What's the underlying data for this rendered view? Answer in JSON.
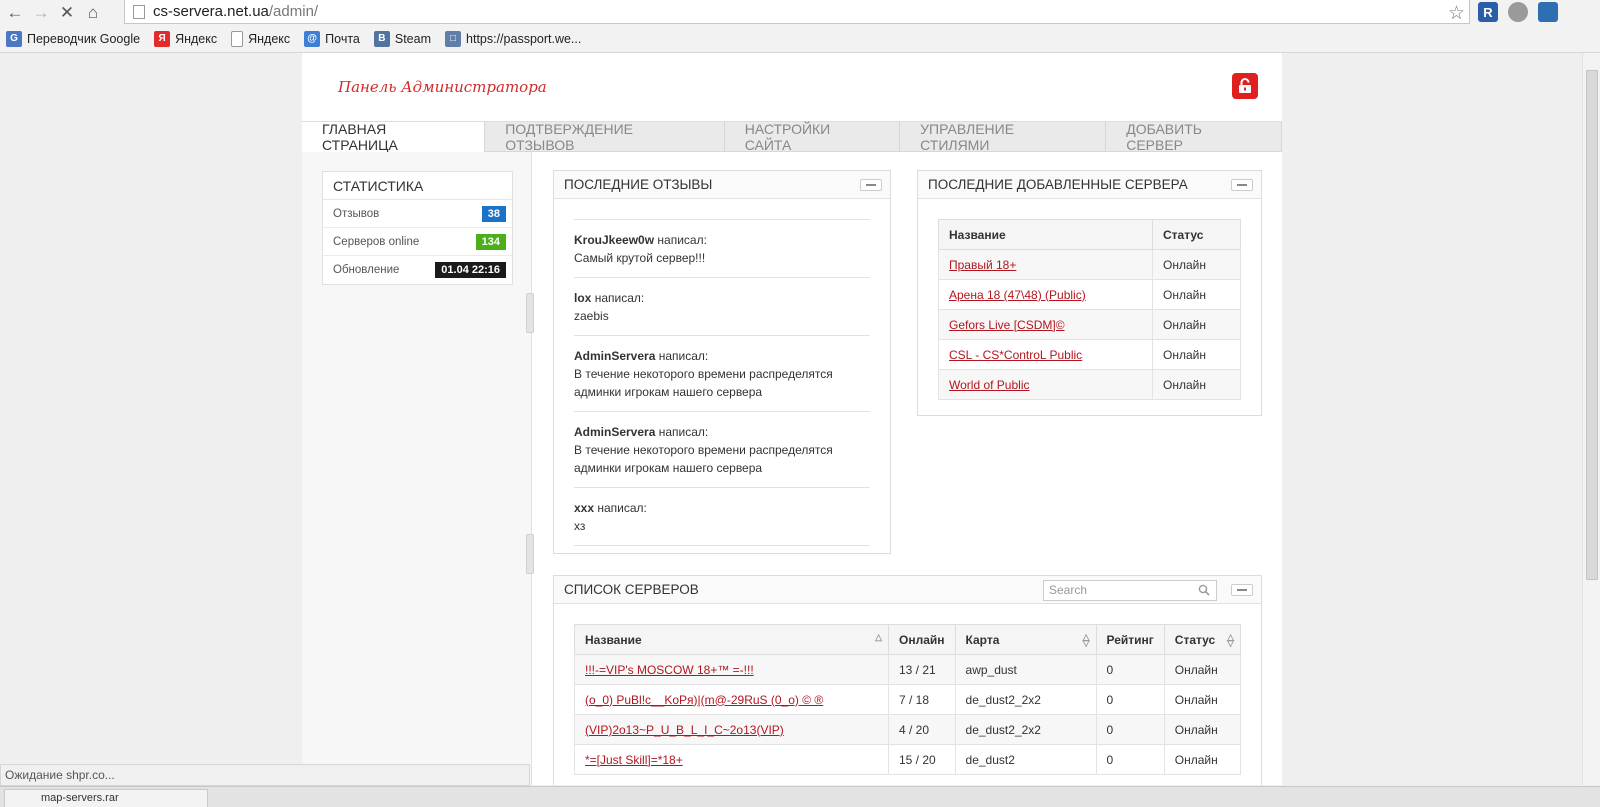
{
  "browser": {
    "url_host": "cs-servera.net.ua",
    "url_path": "/admin/",
    "bookmarks": [
      {
        "label": "Переводчик Google",
        "icon": "google-translate-icon"
      },
      {
        "label": "Яндекс",
        "icon": "yandex-icon"
      },
      {
        "label": "Яндекс",
        "icon": "page-icon"
      },
      {
        "label": "Почта",
        "icon": "mail-icon"
      },
      {
        "label": "Steam",
        "icon": "vk-icon"
      },
      {
        "label": "https://passport.we...",
        "icon": "chat-icon"
      }
    ],
    "status_text": "Ожидание shpr.co...",
    "download_label": "map-servers.rar"
  },
  "header": {
    "title": "Панель Администратора"
  },
  "tabs": [
    {
      "label": "ГЛАВНАЯ СТРАНИЦА",
      "active": true
    },
    {
      "label": "ПОДТВЕРЖДЕНИЕ ОТЗЫВОВ",
      "active": false
    },
    {
      "label": "НАСТРОЙКИ САЙТА",
      "active": false
    },
    {
      "label": "УПРАВЛЕНИЕ СТИЛЯМИ",
      "active": false
    },
    {
      "label": "ДОБАВИТЬ СЕРВЕР",
      "active": false
    }
  ],
  "stats": {
    "title": "СТАТИСТИКА",
    "rows": [
      {
        "label": "Отзывов",
        "value": "38",
        "color": "#1a73c9"
      },
      {
        "label": "Серверов online",
        "value": "134",
        "color": "#4caf1a"
      },
      {
        "label": "Обновление",
        "value": "01.04 22:16",
        "color": "#1a1a1a"
      }
    ]
  },
  "reviews": {
    "title": "ПОСЛЕДНИЕ ОТЗЫВЫ",
    "items": [
      {
        "author": "KrouJkeew0w",
        "wrote": "написал:",
        "text": "Самый крутой сервер!!!"
      },
      {
        "author": "lox",
        "wrote": "написал:",
        "text": "zaebis"
      },
      {
        "author": "AdminServera",
        "wrote": "написал:",
        "text": "В течение некоторого времени распределятся админки игрокам нашего сервера"
      },
      {
        "author": "AdminServera",
        "wrote": "написал:",
        "text": "В течение некоторого времени распределятся админки игрокам нашего сервера"
      },
      {
        "author": "xxx",
        "wrote": "написал:",
        "text": "хз"
      }
    ]
  },
  "recent_servers": {
    "title": "ПОСЛЕДНИЕ ДОБАВЛЕННЫЕ СЕРВЕРА",
    "columns": [
      "Название",
      "Статус"
    ],
    "rows": [
      {
        "name": "Правый 18+",
        "status": "Онлайн"
      },
      {
        "name": "Арена 18 (47\\48) (Public)",
        "status": "Онлайн"
      },
      {
        "name": "Gefors Live [CSDM]©",
        "status": "Онлайн"
      },
      {
        "name": "CSL - CS*ControL Public",
        "status": "Онлайн"
      },
      {
        "name": "World of Public",
        "status": "Онлайн"
      }
    ]
  },
  "server_list": {
    "title": "СПИСОК СЕРВЕРОВ",
    "search_placeholder": "Search",
    "columns": [
      "Название",
      "Онлайн",
      "Карта",
      "Рейтинг",
      "Статус"
    ],
    "rows": [
      {
        "name": "!!!-=VIP's MOSCOW 18+™ =-!!!",
        "online": "13 / 21",
        "map": "awp_dust",
        "rating": "0",
        "status": "Онлайн"
      },
      {
        "name": "(o_0) PuBl!c__KoPя)|(m@-29RuS (0_o) © ®",
        "online": "7 / 18",
        "map": "de_dust2_2x2",
        "rating": "0",
        "status": "Онлайн"
      },
      {
        "name": "(VIP)2o13~P_U_B_L_I_C~2o13(VIP)",
        "online": "4 / 20",
        "map": "de_dust2_2x2",
        "rating": "0",
        "status": "Онлайн"
      },
      {
        "name": "*=[Just Skill]=*18+",
        "online": "15 / 20",
        "map": "de_dust2",
        "rating": "0",
        "status": "Онлайн"
      }
    ]
  }
}
